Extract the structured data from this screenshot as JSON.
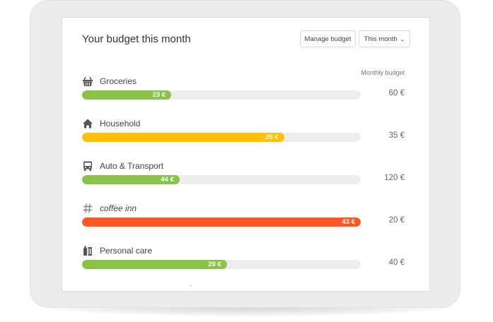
{
  "header": {
    "title": "Your budget this month",
    "manage_button": "Manage budget",
    "period_select": "This month"
  },
  "table": {
    "column_header": "Monthly budget"
  },
  "colors": {
    "green": "#8bc34a",
    "amber": "#ffc107",
    "orange_red": "#ff5722"
  },
  "categories": [
    {
      "label": "Groceries",
      "icon": "basket-icon",
      "spent": "23 €",
      "spent_fraction": 0.32,
      "budget": "60 €",
      "color": "#8bc34a",
      "italic": false
    },
    {
      "label": "Household",
      "icon": "house-icon",
      "spent": "25 €",
      "spent_fraction": 0.725,
      "budget": "35 €",
      "color": "#ffc107",
      "italic": false
    },
    {
      "label": "Auto & Transport",
      "icon": "bus-icon",
      "spent": "44 €",
      "spent_fraction": 0.35,
      "budget": "120 €",
      "color": "#8bc34a",
      "italic": false
    },
    {
      "label": "coffee inn",
      "icon": "hashtag-icon",
      "spent": "43 €",
      "spent_fraction": 1.0,
      "budget": "20 €",
      "color": "#ff5722",
      "italic": true
    },
    {
      "label": "Personal care",
      "icon": "toiletries-icon",
      "spent": "20 €",
      "spent_fraction": 0.52,
      "budget": "40 €",
      "color": "#8bc34a",
      "italic": false
    }
  ]
}
